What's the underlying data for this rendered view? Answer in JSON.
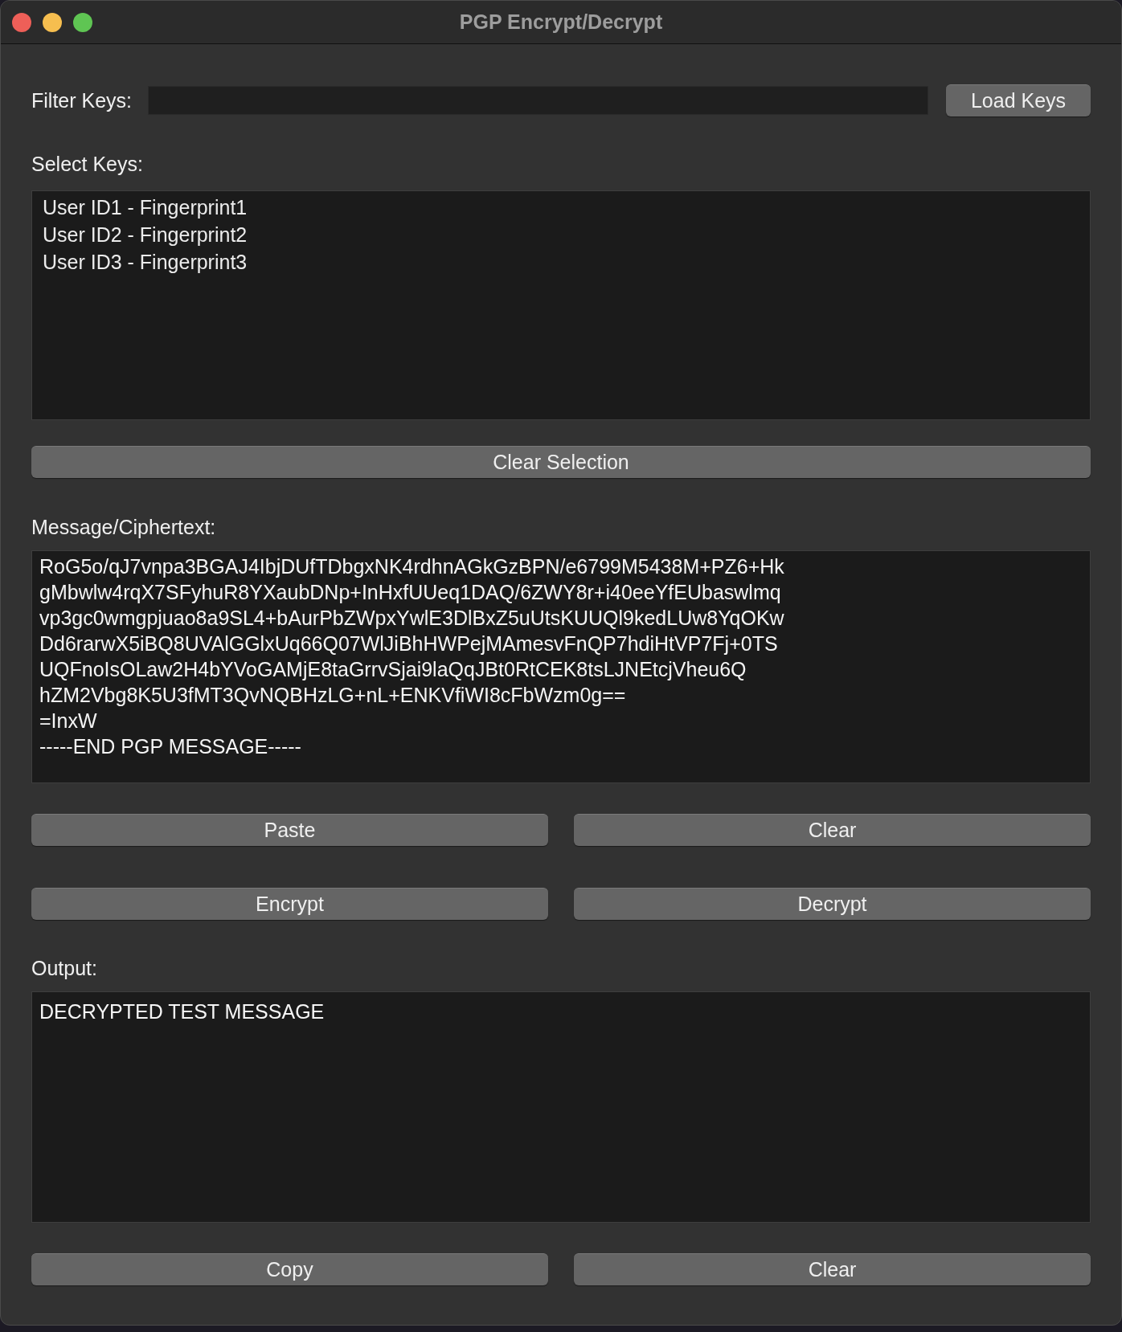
{
  "window": {
    "title": "PGP Encrypt/Decrypt"
  },
  "filter": {
    "label": "Filter Keys:",
    "button": "Load Keys"
  },
  "keys": {
    "label": "Select Keys:",
    "items": [
      {
        "text": "User ID1 - Fingerprint1",
        "selected": false
      },
      {
        "text": "User ID2 - Fingerprint2",
        "selected": false
      },
      {
        "text": "User ID3 - Fingerprint3",
        "selected": false
      }
    ],
    "clear_button": "Clear Selection"
  },
  "message": {
    "label": "Message/Ciphertext:",
    "lines": [
      "RoG5o/qJ7vnpa3BGAJ4IbjDUfTDbgxNK4rdhnAGkGzBPN/e6799M5438M+PZ6+Hk",
      "gMbwlw4rqX7SFyhuR8YXaubDNp+InHxfUUeq1DAQ/6ZWY8r+i40eeYfEUbaswlmq",
      "vp3gc0wmgpjuao8a9SL4+bAurPbZWpxYwlE3DlBxZ5uUtsKUUQl9kedLUw8YqOKw",
      "Dd6rarwX5iBQ8UVAlGGlxUq66Q07WlJiBhHWPejMAmesvFnQP7hdiHtVP7Fj+0TS",
      "UQFnoIsOLaw2H4bYVoGAMjE8taGrrvSjai9laQqJBt0RtCEK8tsLJNEtcjVheu6Q",
      "hZM2Vbg8K5U3fMT3QvNQBHzLG+nL+ENKVfiWI8cFbWzm0g==",
      "=InxW",
      "-----END PGP MESSAGE-----"
    ],
    "buttons": [
      "Paste",
      "Clear"
    ]
  },
  "actions": [
    "Encrypt",
    "Decrypt"
  ],
  "output": {
    "label": "Output:",
    "lines": [
      "DECRYPTED TEST MESSAGE"
    ],
    "buttons": [
      "Copy",
      "Clear"
    ]
  }
}
